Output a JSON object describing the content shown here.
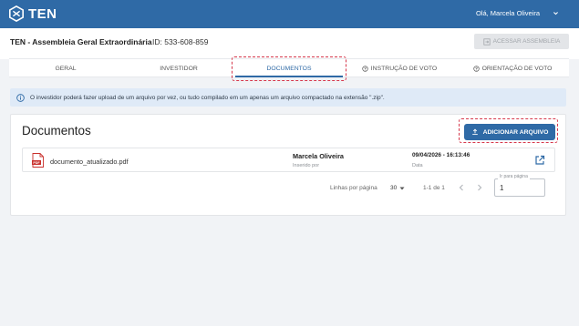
{
  "header": {
    "logo_text": "TEN",
    "user_greeting": "Olá, Marcela Oliveira"
  },
  "assembly": {
    "title": "TEN - Assembleia Geral Extraordinária",
    "id_text": "ID: 533-608-859",
    "access_button": "ACESSAR ASSEMBLEIA"
  },
  "tabs": [
    {
      "label": "GERAL",
      "icon": ""
    },
    {
      "label": "INVESTIDOR",
      "icon": ""
    },
    {
      "label": "DOCUMENTOS",
      "icon": "",
      "active": true
    },
    {
      "label": "INSTRUÇÃO DE VOTO",
      "icon": "help-circle-icon"
    },
    {
      "label": "ORIENTAÇÃO DE VOTO",
      "icon": "help-circle-icon"
    }
  ],
  "info_banner": {
    "icon": "info-icon",
    "text": "O investidor poderá fazer upload de um arquivo por vez, ou tudo compilado em um apenas um arquivo compactado na extensão \".zip\"."
  },
  "documents": {
    "title": "Documentos",
    "add_button": "ADICIONAR ARQUIVO",
    "rows": [
      {
        "file_icon": "pdf-file-icon",
        "file_name": "documento_atualizado.pdf",
        "uploader": "Marcela Oliveira",
        "uploader_label": "Inserido por",
        "date": "09/04/2026 - 16:13:46",
        "date_label": "Data",
        "action_icon": "open-external-icon"
      }
    ]
  },
  "pagination": {
    "rows_per_page_label": "Linhas por página",
    "rows_per_page_value": "30",
    "range_text": "1-1 de 1",
    "goto_label": "Ir para página",
    "goto_value": "1"
  },
  "colors": {
    "primary": "#2f6aa6",
    "highlight": "#d6384c",
    "info_bg": "#dfeaf7",
    "background": "#f1f3f6"
  }
}
